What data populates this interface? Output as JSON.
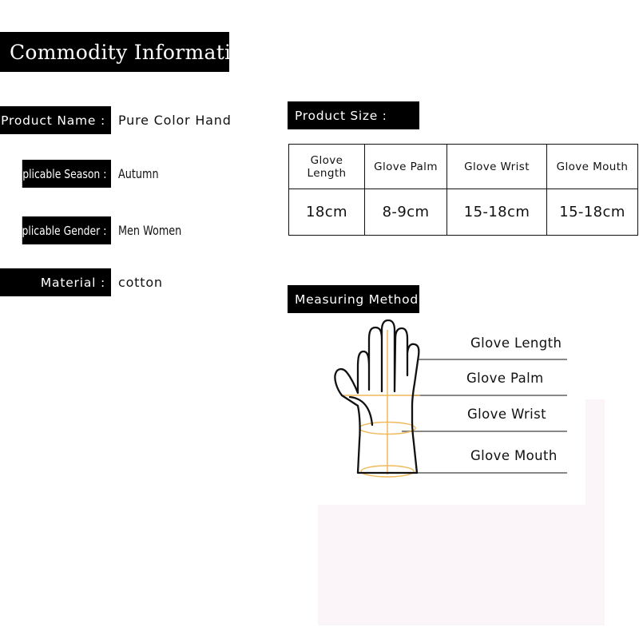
{
  "header": {
    "title": "Commodity Information"
  },
  "info": {
    "rows": [
      {
        "label": "Product Name :",
        "value": "Pure Color Hand",
        "style": "wide"
      },
      {
        "label": "Applicable Season :",
        "value": "Autumn",
        "style": "cond"
      },
      {
        "label": "Applicable Gender :",
        "value": "Men Women",
        "style": "cond"
      },
      {
        "label": "Material :",
        "value": "cotton",
        "style": "wide"
      }
    ]
  },
  "size_section": {
    "heading": "Product Size :",
    "table": {
      "headers": [
        "Glove Length",
        "Glove Palm",
        "Glove Wrist",
        "Glove Mouth"
      ],
      "values": [
        "18cm",
        "8-9cm",
        "15-18cm",
        "15-18cm"
      ]
    }
  },
  "method_section": {
    "heading": "Measuring Method :",
    "labels": [
      "Glove Length",
      "Glove Palm",
      "Glove Wrist",
      "Glove Mouth"
    ],
    "diagram": {
      "name": "hand-measurement-diagram",
      "outline_color": "#111111",
      "guide_color": "#f0b95a",
      "rule_color": "#888888"
    }
  },
  "decor": {
    "panel_color": "#fbf4f9"
  },
  "colors": {
    "banner_bg": "#000000",
    "banner_text": "#ffffff",
    "body_text": "#111111",
    "page_bg": "#ffffff"
  }
}
